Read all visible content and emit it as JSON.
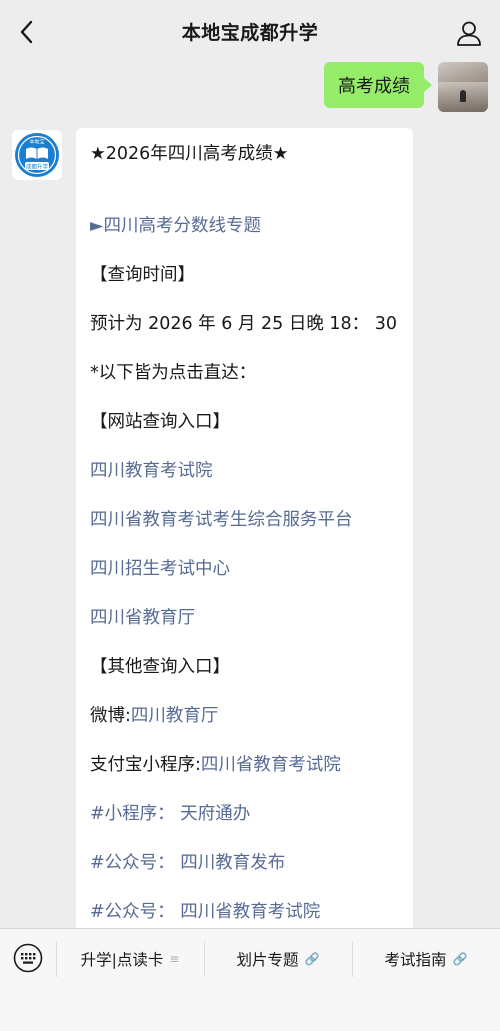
{
  "header": {
    "title": "本地宝成都升学",
    "back_icon": "chevron-left-icon",
    "profile_icon": "person-icon"
  },
  "user_message": {
    "text": "高考成绩"
  },
  "bot_avatar": {
    "top_text": "本地宝",
    "bottom_text": "成都升学",
    "brand_color": "#1b7fd1"
  },
  "bot_message": {
    "headline": "★2026年四川高考成绩★",
    "topic_link": "►四川高考分数线专题",
    "query_time_heading": "【查询时间】",
    "query_time_value": "预计为 2026 年 6 月 25 日晚 18： 30",
    "note": "*以下皆为点击直达：",
    "website_heading": "【网站查询入口】",
    "website_links": [
      "四川教育考试院",
      "四川省教育考试考生综合服务平台",
      "四川招生考试中心",
      "四川省教育厅"
    ],
    "other_heading": "【其他查询入口】",
    "weibo_label": "微博:",
    "weibo_link": "四川教育厅",
    "alipay_label": "支付宝小程序:",
    "alipay_link": "四川省教育考试院",
    "mini_program": "#小程序： 天府通办",
    "public_account_1": "#公众号： 四川教育发布",
    "public_account_2": "#公众号： 四川省教育考试院"
  },
  "bottom_menu": {
    "keyboard_icon": "keyboard-icon",
    "items": [
      {
        "label": "升学|点读卡",
        "suffix": "≡"
      },
      {
        "label": "划片专题",
        "suffix": "🔗"
      },
      {
        "label": "考试指南",
        "suffix": "🔗"
      }
    ]
  },
  "colors": {
    "background": "#ededed",
    "user_bubble": "#95ec69",
    "link": "#576b95"
  }
}
